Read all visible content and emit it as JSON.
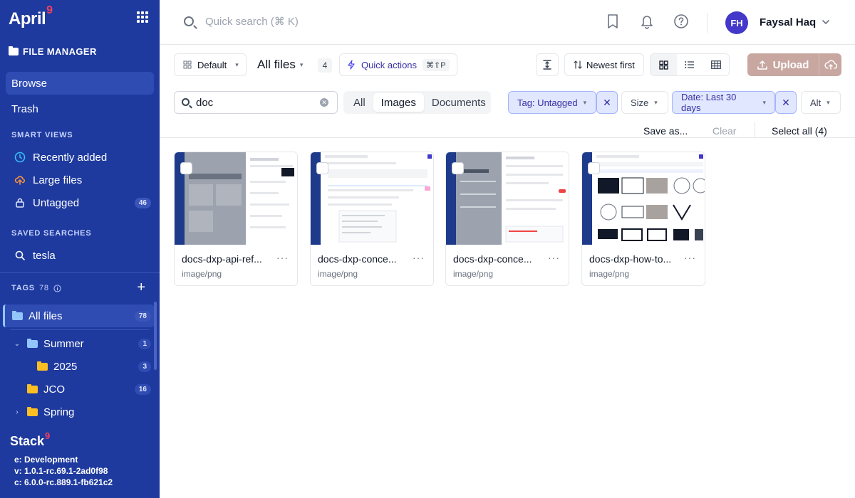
{
  "sidebar": {
    "brand": "April",
    "brand_sup": "9",
    "section_title": "FILE MANAGER",
    "nav": [
      {
        "label": "Browse",
        "active": true
      },
      {
        "label": "Trash",
        "active": false
      }
    ],
    "smart_views_title": "SMART VIEWS",
    "smart_views": [
      {
        "label": "Recently added",
        "icon": "clock-icon",
        "color": "#38bdf8"
      },
      {
        "label": "Large files",
        "icon": "cloud-upload-icon",
        "color": "#fb923c"
      },
      {
        "label": "Untagged",
        "icon": "lock-icon",
        "badge": "46"
      }
    ],
    "saved_searches_title": "SAVED SEARCHES",
    "saved_searches": [
      {
        "label": "tesla",
        "icon": "search-icon"
      }
    ],
    "tags_title": "TAGS",
    "tags_count": "78",
    "tree": [
      {
        "label": "All files",
        "badge": "78",
        "active": true
      },
      {
        "label": "Summer",
        "badge": "1",
        "expanded": true
      },
      {
        "label": "2025",
        "badge": "3"
      },
      {
        "label": "JCO",
        "badge": "16"
      },
      {
        "label": "Spring",
        "badge": ""
      }
    ],
    "stack_name": "Stack",
    "stack_sup": "9",
    "env_lines": [
      "e: Development",
      "v: 1.0.1-rc.69.1-2ad0f98",
      "c: 6.0.0-rc.889.1-fb621c2"
    ]
  },
  "header": {
    "search_placeholder": "Quick search (⌘ K)",
    "user_initials": "FH",
    "user_name": "Faysal Haq"
  },
  "toolbar": {
    "view_select": "Default",
    "breadcrumb": "All files",
    "count": "4",
    "quick_actions": "Quick actions",
    "quick_actions_kbd": "⌘⇧P",
    "sort": "Newest first",
    "view_mode": "grid",
    "upload": "Upload"
  },
  "filters": {
    "search_value": "doc",
    "types": [
      "All",
      "Images",
      "Documents"
    ],
    "active_type": "Images",
    "tag_chip": "Tag: Untagged",
    "size_chip": "Size",
    "date_chip": "Date: Last 30 days",
    "alt_chip": "Alt"
  },
  "actions": {
    "save_as": "Save as...",
    "clear": "Clear",
    "select_all": "Select all (4)"
  },
  "files": [
    {
      "name": "docs-dxp-api-ref...",
      "type": "image/png"
    },
    {
      "name": "docs-dxp-conce...",
      "type": "image/png"
    },
    {
      "name": "docs-dxp-conce...",
      "type": "image/png"
    },
    {
      "name": "docs-dxp-how-to...",
      "type": "image/png"
    }
  ],
  "colors": {
    "sidebar_bg": "#1e3a9e",
    "accent": "#4338ca",
    "upload_bg": "#c8a7a1",
    "chip_blue": "#e0e7ff"
  }
}
